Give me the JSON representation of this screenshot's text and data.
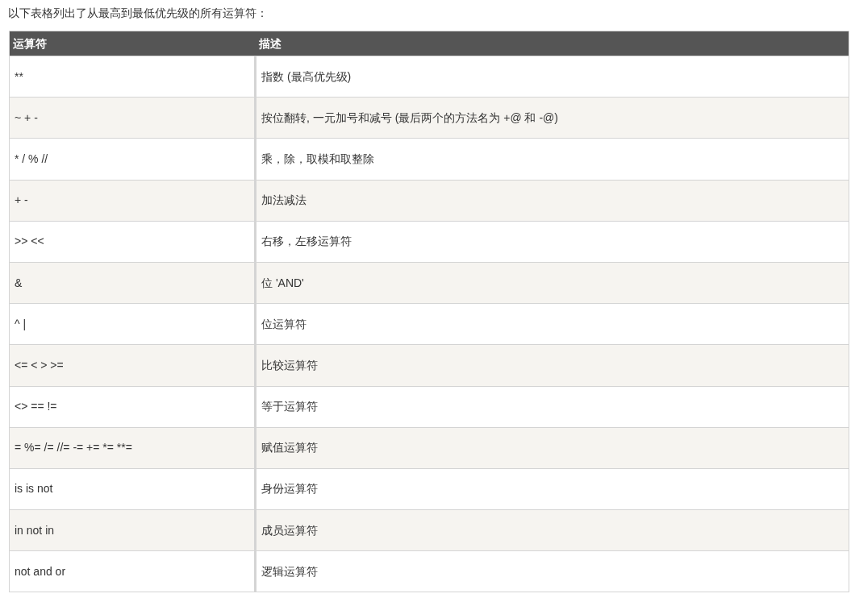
{
  "intro": "以下表格列出了从最高到最低优先级的所有运算符：",
  "table": {
    "columns": [
      "运算符",
      "描述"
    ],
    "rows": [
      [
        "**",
        "指数 (最高优先级)"
      ],
      [
        "~ + -",
        "按位翻转, 一元加号和减号 (最后两个的方法名为 +@ 和 -@)"
      ],
      [
        "* / % //",
        "乘，除，取模和取整除"
      ],
      [
        "+ -",
        "加法减法"
      ],
      [
        ">> <<",
        "右移，左移运算符"
      ],
      [
        "&",
        "位 'AND'"
      ],
      [
        "^ |",
        "位运算符"
      ],
      [
        "<= < > >=",
        "比较运算符"
      ],
      [
        "<> == !=",
        "等于运算符"
      ],
      [
        "= %= /= //= -= += *= **=",
        "赋值运算符"
      ],
      [
        "is is not",
        "身份运算符"
      ],
      [
        "in not in",
        "成员运算符"
      ],
      [
        "not and or",
        "逻辑运算符"
      ]
    ]
  }
}
